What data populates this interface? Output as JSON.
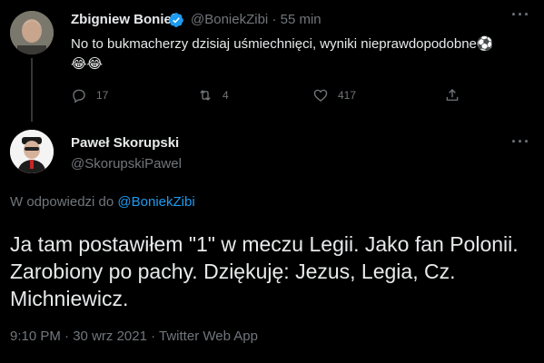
{
  "parent_tweet": {
    "author_name": "Zbigniew Boniek",
    "author_handle": "@BoniekZibi",
    "separator": "·",
    "time_ago": "55 min",
    "text": "No to bukmacherzy dzisiaj uśmiechnięci, wyniki nieprawdopodobne",
    "emojis": "⚽😂😂",
    "reply_count": "17",
    "retweet_count": "4",
    "like_count": "417",
    "verified_color": "#1d9bf0"
  },
  "main_tweet": {
    "author_name": "Paweł Skorupski",
    "author_handle": "@SkorupskiPawel",
    "reply_context_prefix": "W odpowiedzi do ",
    "reply_context_mention": "@BoniekZibi",
    "text": "Ja tam postawiłem \"1\" w meczu Legii. Jako fan Polonii. Zarobiony po pachy. Dziękuję: Jezus, Legia, Cz. Michniewicz.",
    "time": "9:10 PM",
    "date": "30 wrz 2021",
    "source": "Twitter Web App",
    "separator": "·"
  },
  "icons": {
    "reply": "reply-icon",
    "retweet": "retweet-icon",
    "like": "heart-icon",
    "share": "share-icon",
    "more": "more-icon",
    "verified": "verified-badge-icon"
  },
  "more_glyph": "···",
  "colors": {
    "background": "#000000",
    "text_primary": "#e7e9ea",
    "text_secondary": "#71767b",
    "accent": "#1d9bf0"
  }
}
